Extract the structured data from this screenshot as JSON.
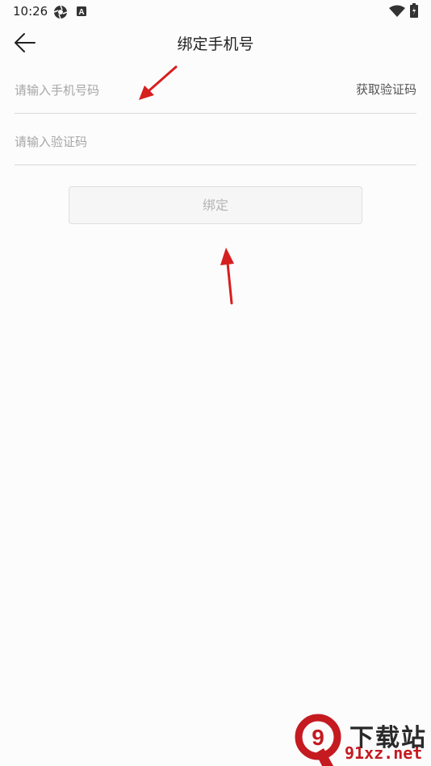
{
  "status_bar": {
    "time": "10:26",
    "icons": [
      "aperture-icon",
      "a-letter-icon",
      "wifi-icon",
      "battery-charging-icon"
    ]
  },
  "header": {
    "title": "绑定手机号",
    "back_icon": "arrow-left-icon"
  },
  "form": {
    "phone": {
      "placeholder": "请输入手机号码",
      "value": ""
    },
    "get_code_label": "获取验证码",
    "code": {
      "placeholder": "请输入验证码",
      "value": ""
    },
    "bind_button_label": "绑定"
  },
  "annotations": {
    "arrow_color": "#d61f1f"
  },
  "watermark": {
    "logo_text": "9",
    "title": "下载站",
    "site": "91xz.net"
  },
  "colors": {
    "background": "#fdfcfd",
    "button_bg": "#f6f6f6",
    "button_text": "#b4b4b4",
    "watermark_red": "#c41a20"
  }
}
